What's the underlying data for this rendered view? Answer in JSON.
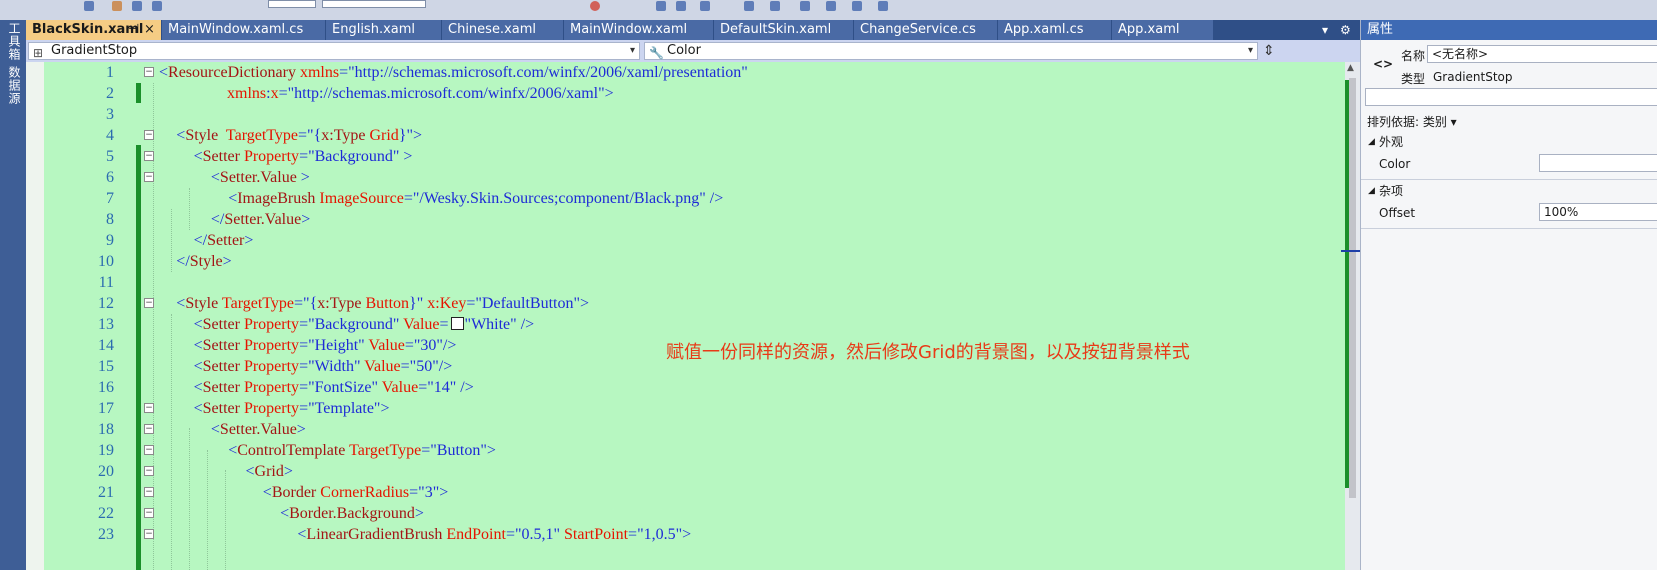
{
  "tabs": [
    {
      "label": "BlackSkin.xaml",
      "active": true,
      "pin": "⊣",
      "close": "×"
    },
    {
      "label": "MainWindow.xaml.cs"
    },
    {
      "label": "English.xaml"
    },
    {
      "label": "Chinese.xaml"
    },
    {
      "label": "MainWindow.xaml"
    },
    {
      "label": "DefaultSkin.xaml"
    },
    {
      "label": "ChangeService.cs"
    },
    {
      "label": "App.xaml.cs"
    },
    {
      "label": "App.xaml"
    }
  ],
  "tab_overflow": "▾",
  "tab_settings": "⚙",
  "left_tool_tabs": [
    "工具箱",
    "数据源"
  ],
  "nav": {
    "left_combo": "GradientStop",
    "right_combo": "Color",
    "left_icon": "⊞",
    "right_icon": "🔧",
    "dropdown": "▾",
    "split": "⇕"
  },
  "annotation": "赋值一份同样的资源，然后修改Grid的背景图，以及按钮背景样式",
  "code_lines": [
    {
      "n": "1",
      "indent": 0,
      "fold": "−",
      "tokens": [
        [
          "b",
          "<"
        ],
        [
          "t",
          "ResourceDictionary"
        ],
        [
          "a",
          " xmlns"
        ],
        [
          "b",
          "=\"http://schemas.microsoft.com/winfx/2006/xaml/presentation\""
        ]
      ]
    },
    {
      "n": "2",
      "indent": 0,
      "fold": "",
      "tokens": [
        [
          "a",
          "                 xmlns"
        ],
        [
          "b",
          ":"
        ],
        [
          "a",
          "x"
        ],
        [
          "b",
          "=\"http://schemas.microsoft.com/winfx/2006/xaml\">"
        ]
      ]
    },
    {
      "n": "3",
      "indent": 0,
      "fold": "",
      "tokens": []
    },
    {
      "n": "4",
      "indent": 1,
      "fold": "−",
      "tokens": [
        [
          "b",
          "<"
        ],
        [
          "t",
          "Style"
        ],
        [
          "a",
          "  TargetType"
        ],
        [
          "b",
          "=\"{"
        ],
        [
          "t",
          "x:Type"
        ],
        [
          "a",
          " Grid"
        ],
        [
          "b",
          "}\">"
        ]
      ]
    },
    {
      "n": "5",
      "indent": 2,
      "fold": "−",
      "tokens": [
        [
          "b",
          "<"
        ],
        [
          "t",
          "Setter"
        ],
        [
          "a",
          " Property"
        ],
        [
          "b",
          "=\"Background\" >"
        ]
      ]
    },
    {
      "n": "6",
      "indent": 3,
      "fold": "−",
      "tokens": [
        [
          "b",
          "<"
        ],
        [
          "t",
          "Setter.Value"
        ],
        [
          "b",
          " >"
        ]
      ]
    },
    {
      "n": "7",
      "indent": 4,
      "fold": "",
      "tokens": [
        [
          "b",
          "<"
        ],
        [
          "t",
          "ImageBrush"
        ],
        [
          "a",
          " ImageSource"
        ],
        [
          "b",
          "=\"/Wesky.Skin.Sources;component/Black.png\" />"
        ]
      ]
    },
    {
      "n": "8",
      "indent": 3,
      "fold": "",
      "tokens": [
        [
          "b",
          "</"
        ],
        [
          "t",
          "Setter.Value"
        ],
        [
          "b",
          ">"
        ]
      ]
    },
    {
      "n": "9",
      "indent": 2,
      "fold": "",
      "tokens": [
        [
          "b",
          "</"
        ],
        [
          "t",
          "Setter"
        ],
        [
          "b",
          ">"
        ]
      ]
    },
    {
      "n": "10",
      "indent": 1,
      "fold": "",
      "tokens": [
        [
          "b",
          "</"
        ],
        [
          "t",
          "Style"
        ],
        [
          "b",
          ">"
        ]
      ]
    },
    {
      "n": "11",
      "indent": 0,
      "fold": "",
      "tokens": []
    },
    {
      "n": "12",
      "indent": 1,
      "fold": "−",
      "tokens": [
        [
          "b",
          "<"
        ],
        [
          "t",
          "Style"
        ],
        [
          "a",
          " TargetType"
        ],
        [
          "b",
          "=\"{"
        ],
        [
          "t",
          "x:Type"
        ],
        [
          "a",
          " Button"
        ],
        [
          "b",
          "}\" "
        ],
        [
          "a",
          "x:Key"
        ],
        [
          "b",
          "=\"DefaultButton\">"
        ]
      ]
    },
    {
      "n": "13",
      "indent": 2,
      "fold": "",
      "tokens": [
        [
          "b",
          "<"
        ],
        [
          "t",
          "Setter"
        ],
        [
          "a",
          " Property"
        ],
        [
          "b",
          "=\"Background\" "
        ],
        [
          "a",
          "Value"
        ],
        [
          "b",
          "="
        ],
        [
          "swatch",
          ""
        ],
        [
          "b",
          "\"White\" />"
        ]
      ]
    },
    {
      "n": "14",
      "indent": 2,
      "fold": "",
      "tokens": [
        [
          "b",
          "<"
        ],
        [
          "t",
          "Setter"
        ],
        [
          "a",
          " Property"
        ],
        [
          "b",
          "=\"Height\" "
        ],
        [
          "a",
          "Value"
        ],
        [
          "b",
          "=\"30\"/>"
        ]
      ]
    },
    {
      "n": "15",
      "indent": 2,
      "fold": "",
      "tokens": [
        [
          "b",
          "<"
        ],
        [
          "t",
          "Setter"
        ],
        [
          "a",
          " Property"
        ],
        [
          "b",
          "=\"Width\" "
        ],
        [
          "a",
          "Value"
        ],
        [
          "b",
          "=\"50\"/>"
        ]
      ]
    },
    {
      "n": "16",
      "indent": 2,
      "fold": "",
      "tokens": [
        [
          "b",
          "<"
        ],
        [
          "t",
          "Setter"
        ],
        [
          "a",
          " Property"
        ],
        [
          "b",
          "=\"FontSize\" "
        ],
        [
          "a",
          "Value"
        ],
        [
          "b",
          "=\"14\" />"
        ]
      ]
    },
    {
      "n": "17",
      "indent": 2,
      "fold": "−",
      "tokens": [
        [
          "b",
          "<"
        ],
        [
          "t",
          "Setter"
        ],
        [
          "a",
          " Property"
        ],
        [
          "b",
          "=\"Template\">"
        ]
      ]
    },
    {
      "n": "18",
      "indent": 3,
      "fold": "−",
      "tokens": [
        [
          "b",
          "<"
        ],
        [
          "t",
          "Setter.Value"
        ],
        [
          "b",
          ">"
        ]
      ]
    },
    {
      "n": "19",
      "indent": 4,
      "fold": "−",
      "tokens": [
        [
          "b",
          "<"
        ],
        [
          "t",
          "ControlTemplate"
        ],
        [
          "a",
          " TargetType"
        ],
        [
          "b",
          "=\"Button\">"
        ]
      ]
    },
    {
      "n": "20",
      "indent": 5,
      "fold": "−",
      "tokens": [
        [
          "b",
          "<"
        ],
        [
          "t",
          "Grid"
        ],
        [
          "b",
          ">"
        ]
      ]
    },
    {
      "n": "21",
      "indent": 6,
      "fold": "−",
      "tokens": [
        [
          "b",
          "<"
        ],
        [
          "t",
          "Border"
        ],
        [
          "a",
          " CornerRadius"
        ],
        [
          "b",
          "=\"3\">"
        ]
      ]
    },
    {
      "n": "22",
      "indent": 7,
      "fold": "−",
      "tokens": [
        [
          "b",
          "<"
        ],
        [
          "t",
          "Border.Background"
        ],
        [
          "b",
          ">"
        ]
      ]
    },
    {
      "n": "23",
      "indent": 8,
      "fold": "−",
      "tokens": [
        [
          "b",
          "<"
        ],
        [
          "t",
          "LinearGradientBrush"
        ],
        [
          "a",
          " EndPoint"
        ],
        [
          "b",
          "=\"0.5,1\" "
        ],
        [
          "a",
          "StartPoint"
        ],
        [
          "b",
          "=\"1,0.5\">"
        ]
      ]
    }
  ],
  "properties": {
    "title": "属性",
    "element_icon": "<>",
    "name_label": "名称",
    "name_value": "<无名称>",
    "type_label": "类型",
    "type_value": "GradientStop",
    "search_value": "",
    "sort_label": "排列依据: 类别 ▾",
    "categories": [
      {
        "label": "外观",
        "props": [
          {
            "name": "Color",
            "value": ""
          }
        ]
      },
      {
        "label": "杂项",
        "props": [
          {
            "name": "Offset",
            "value": "100%"
          }
        ]
      }
    ],
    "expand_glyph": "◢"
  },
  "colors": {
    "editor_bg": "#b7f7c1",
    "tag": "#a31515",
    "attribute": "#e51400",
    "value": "#1e2bd6",
    "annotation": "#e83a17",
    "active_tab": "#f5cc84"
  }
}
